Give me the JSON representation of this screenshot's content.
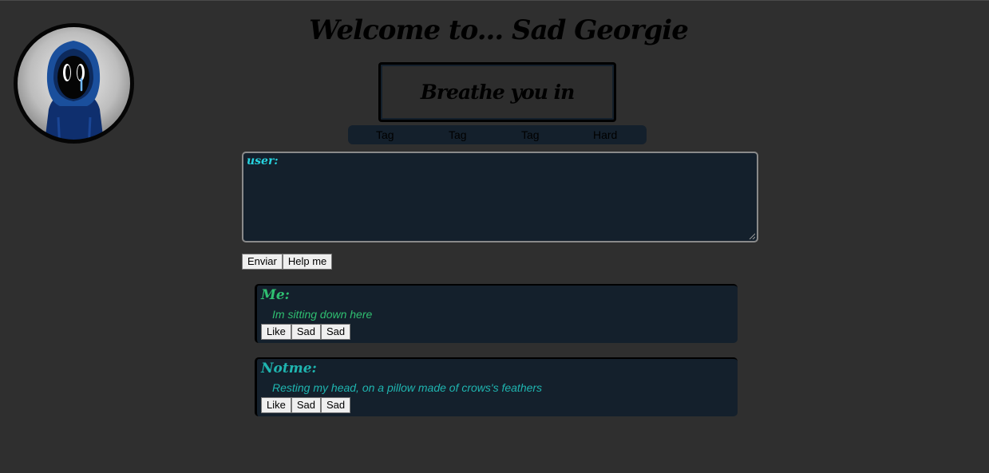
{
  "header": {
    "title": "Welcome to... Sad Georgie",
    "banner": "Breathe you in"
  },
  "tags": [
    "Tag",
    "Tag",
    "Tag",
    "Hard"
  ],
  "composer": {
    "user_label": "user:",
    "value": ""
  },
  "buttons": {
    "send": "Enviar",
    "help": "Help me"
  },
  "posts": [
    {
      "author": "Me:",
      "message": "Im sitting down here",
      "color": "#2fbf71",
      "actions": [
        "Like",
        "Sad",
        "Sad"
      ]
    },
    {
      "author": "Notme:",
      "message": "Resting my head, on a pillow made of crows's feathers",
      "color": "#1fb5b0",
      "actions": [
        "Like",
        "Sad",
        "Sad"
      ]
    }
  ],
  "colors": {
    "background": "#2f2f2f",
    "panel": "#14202c",
    "user_label": "#27d4e0"
  }
}
